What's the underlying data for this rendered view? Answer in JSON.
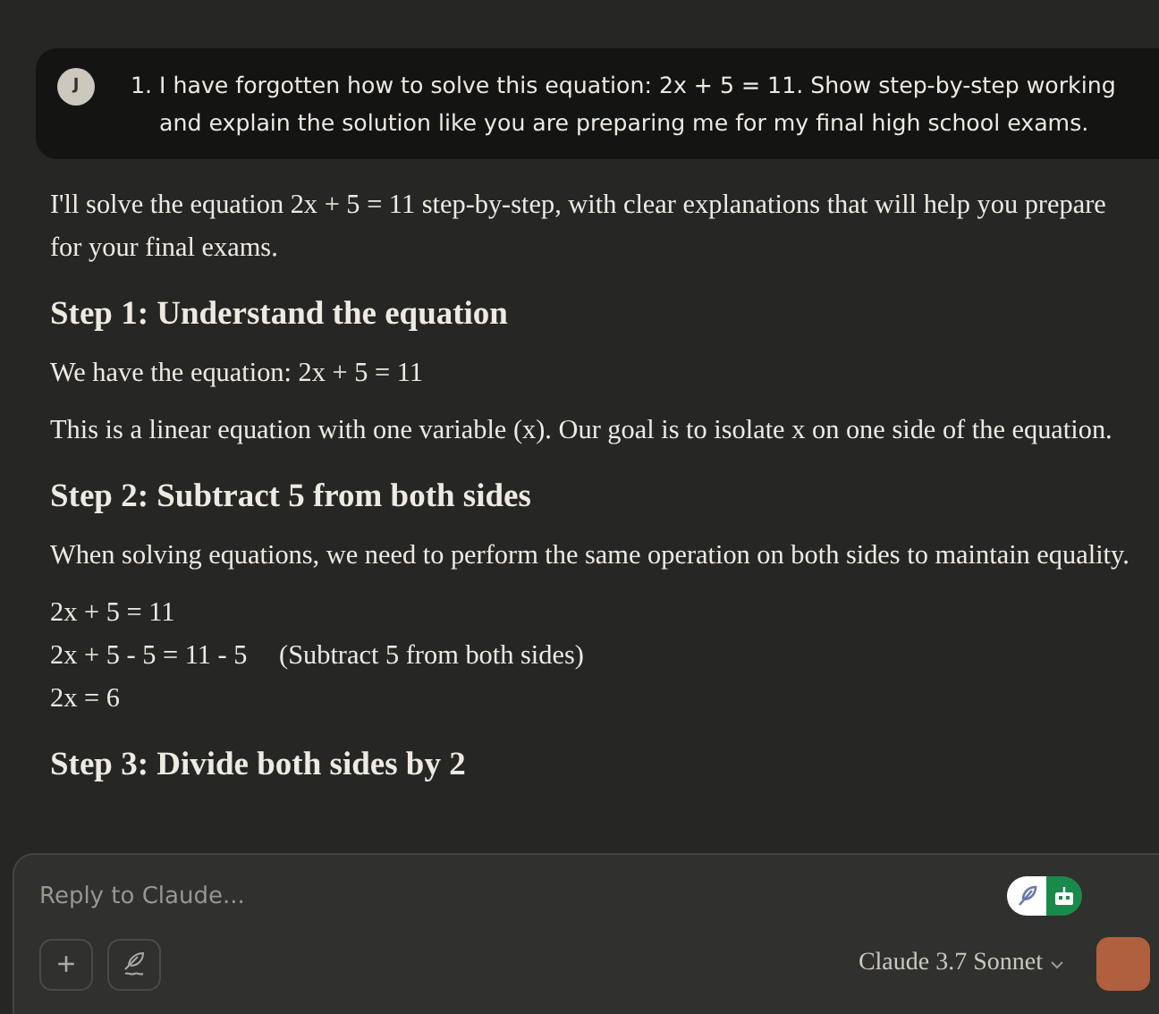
{
  "user_message": {
    "avatar": "J",
    "number": "1.",
    "text": "I have forgotten how to solve this equation: 2x + 5 = 11. Show step-by-step working and explain the solution like you are preparing me for my final high school exams."
  },
  "response": [
    {
      "kind": "paragraph",
      "text": "I'll solve the equation 2x + 5 = 11 step-by-step, with clear explanations that will help you prepare for your final exams."
    },
    {
      "kind": "heading",
      "text": "Step 1: Understand the equation"
    },
    {
      "kind": "paragraph",
      "text": "We have the equation: 2x + 5 = 11"
    },
    {
      "kind": "paragraph",
      "text": "This is a linear equation with one variable (x). Our goal is to isolate x on one side of the equation."
    },
    {
      "kind": "heading",
      "text": "Step 2: Subtract 5 from both sides"
    },
    {
      "kind": "paragraph",
      "text": "When solving equations, we need to perform the same operation on both sides to maintain equality."
    },
    {
      "kind": "lines",
      "lines": [
        {
          "math": "2x + 5 = 11"
        },
        {
          "math": "2x + 5 - 5 = 11 - 5",
          "note": "(Subtract 5 from both sides)"
        },
        {
          "math": "2x = 6"
        }
      ]
    },
    {
      "kind": "heading",
      "text": "Step 3: Divide both sides by 2"
    }
  ],
  "composer": {
    "placeholder": "Reply to Claude...",
    "model": "Claude 3.7 Sonnet",
    "add": "+"
  }
}
